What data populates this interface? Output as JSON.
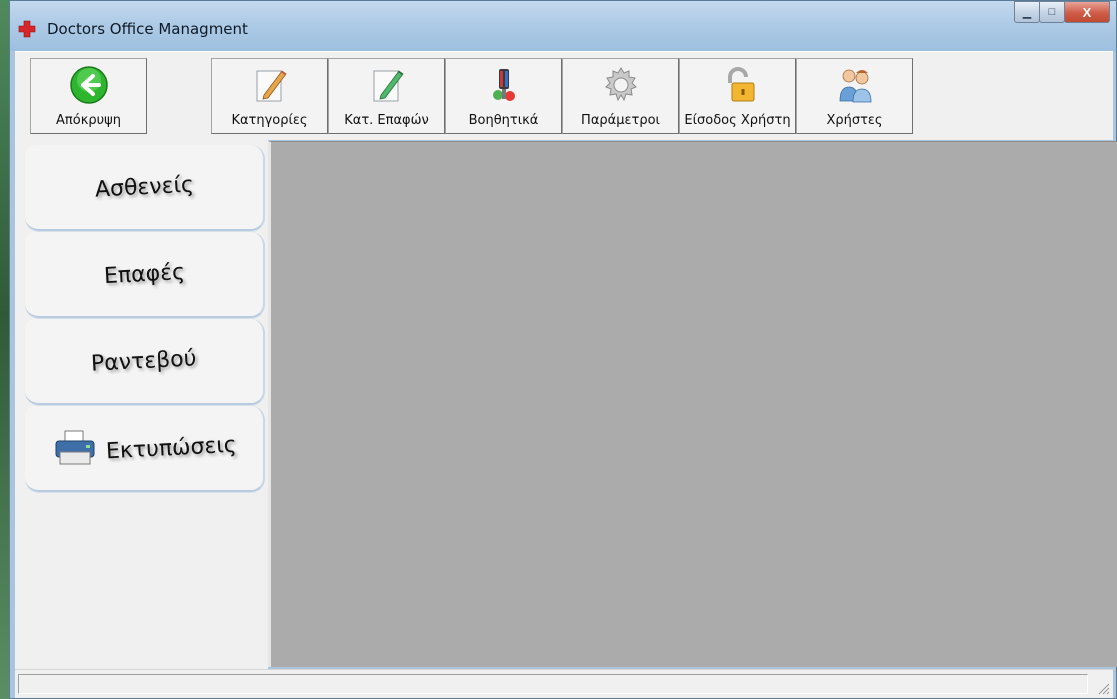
{
  "window": {
    "title": "Doctors Office Managment",
    "controls": {
      "minimize": "▁",
      "maximize": "□",
      "close": "X"
    }
  },
  "toolbar": {
    "hide_label": "Απόκρυψη",
    "categories_label": "Κατηγορίες",
    "contact_categories_label": "Κατ. Επαφών",
    "utilities_label": "Βοηθητικά",
    "parameters_label": "Παράμετροι",
    "login_label": "Είσοδος Χρήστη",
    "users_label": "Χρήστες"
  },
  "sidebar": {
    "items": [
      {
        "label": "Ασθενείς"
      },
      {
        "label": "Επαφές"
      },
      {
        "label": "Ραντεβού"
      },
      {
        "label": "Εκτυπώσεις"
      }
    ]
  },
  "colors": {
    "workspace": "#ababab",
    "panel": "#f0f0f0",
    "titlebar": "#aecbe6",
    "back_icon": "#2db52d"
  },
  "icons": {
    "hide": "back-arrow-icon",
    "categories": "notepad-pencil-icon",
    "contact_categories": "notepad-pencil-icon",
    "utilities": "tools-icon",
    "parameters": "gear-icon",
    "login": "padlock-icon",
    "users": "users-icon",
    "print": "printer-icon",
    "app": "red-cross-icon"
  }
}
